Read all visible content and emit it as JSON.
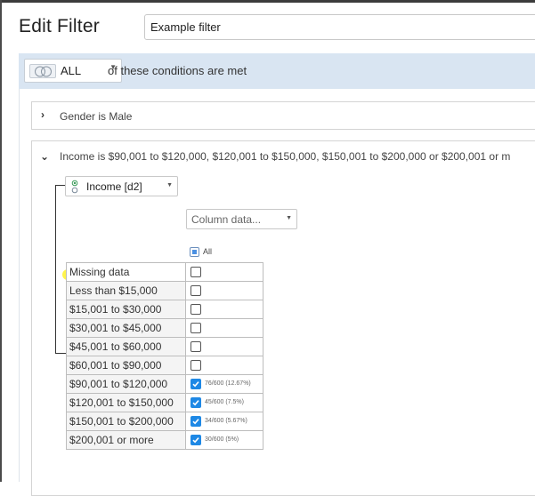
{
  "dialog": {
    "title": "Edit Filter",
    "name_value": "Example filter"
  },
  "condition_bar": {
    "combinator": "ALL",
    "suffix": "of these conditions are met"
  },
  "conditions": [
    {
      "label": "Gender is Male",
      "expanded": false
    },
    {
      "label": "Income is $90,001 to $120,000, $120,001 to $150,000, $150,001 to $200,000 or $200,001 or m",
      "expanded": true
    }
  ],
  "income_condition": {
    "variable": "Income [d2]",
    "column_data_placeholder": "Column data...",
    "all_label": "All",
    "categories": [
      {
        "label": "Missing data",
        "checked": false,
        "count": ""
      },
      {
        "label": "Less than $15,000",
        "checked": false,
        "count": ""
      },
      {
        "label": "$15,001 to $30,000",
        "checked": false,
        "count": ""
      },
      {
        "label": "$30,001 to $45,000",
        "checked": false,
        "count": ""
      },
      {
        "label": "$45,001 to $60,000",
        "checked": false,
        "count": ""
      },
      {
        "label": "$60,001 to $90,000",
        "checked": false,
        "count": ""
      },
      {
        "label": "$90,001 to $120,000",
        "checked": true,
        "count": "76/600 (12.67%)"
      },
      {
        "label": "$120,001 to $150,000",
        "checked": true,
        "count": "45/600 (7.5%)"
      },
      {
        "label": "$150,001 to $200,000",
        "checked": true,
        "count": "34/600 (5.67%)"
      },
      {
        "label": "$200,001 or more",
        "checked": true,
        "count": "30/600 (5%)"
      }
    ]
  },
  "colors": {
    "condition_bar_bg": "#d9e5f2",
    "checkbox_checked": "#1e88e5",
    "highlight": "#fff22b"
  }
}
